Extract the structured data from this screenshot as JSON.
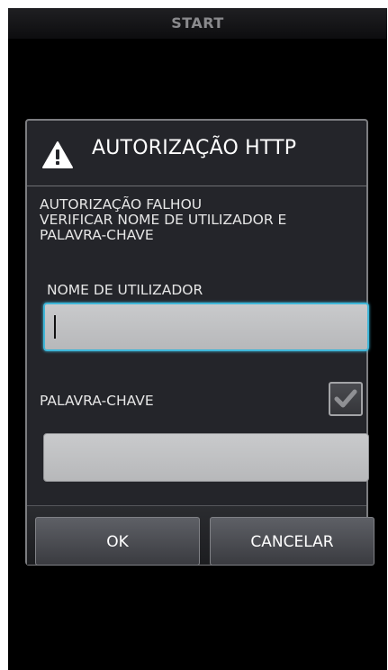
{
  "app_bar": {
    "title": "START"
  },
  "dialog": {
    "title": "AUTORIZAÇÃO HTTP",
    "icon": "warning-icon",
    "message": "AUTORIZAÇÃO FALHOU\n VERIFICAR NOME DE UTILIZADOR E\nPALAVRA-CHAVE",
    "username_label": "NOME DE UTILIZADOR",
    "username_value": "",
    "password_label": "PALAVRA-CHAVE",
    "password_value": "",
    "show_password_checked": true,
    "ok_label": "OK",
    "cancel_label": "CANCELAR"
  },
  "colors": {
    "focus": "#3fb6d8",
    "dialog_bg": "#24252a"
  }
}
